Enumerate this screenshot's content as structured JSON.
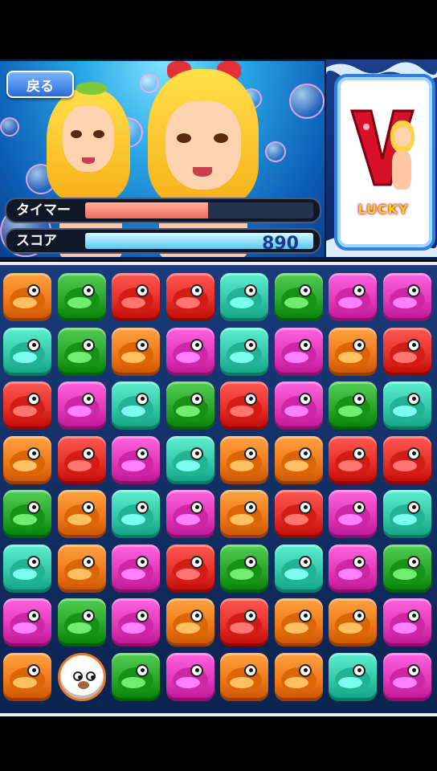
{
  "header": {
    "back_label": "戻る"
  },
  "meters": {
    "timer_label": "タイマー",
    "timer_fraction": 0.54,
    "score_label": "スコア",
    "score_value": "890",
    "score_fraction": 1.0
  },
  "lucky": {
    "letter": "V",
    "label": "LUCKY"
  },
  "piece_colors": {
    "orange": "#f07a1a",
    "green": "#2aa62a",
    "red": "#e8302a",
    "teal": "#35c8a8",
    "magenta": "#e23ab8",
    "otter": "#ffffff"
  },
  "board": [
    [
      "orange",
      "green",
      "red",
      "red",
      "teal",
      "green",
      "magenta",
      "magenta"
    ],
    [
      "teal",
      "green",
      "orange",
      "magenta",
      "teal",
      "magenta",
      "orange",
      "red"
    ],
    [
      "red",
      "magenta",
      "teal",
      "green",
      "red",
      "magenta",
      "green",
      "teal"
    ],
    [
      "orange",
      "red",
      "magenta",
      "teal",
      "orange",
      "orange",
      "red",
      "red"
    ],
    [
      "green",
      "orange",
      "teal",
      "magenta",
      "orange",
      "red",
      "magenta",
      "teal"
    ],
    [
      "teal",
      "orange",
      "magenta",
      "red",
      "green",
      "teal",
      "magenta",
      "green"
    ],
    [
      "magenta",
      "green",
      "magenta",
      "orange",
      "red",
      "orange",
      "orange",
      "magenta"
    ],
    [
      "orange",
      "otter",
      "green",
      "magenta",
      "orange",
      "orange",
      "teal",
      "magenta"
    ]
  ]
}
